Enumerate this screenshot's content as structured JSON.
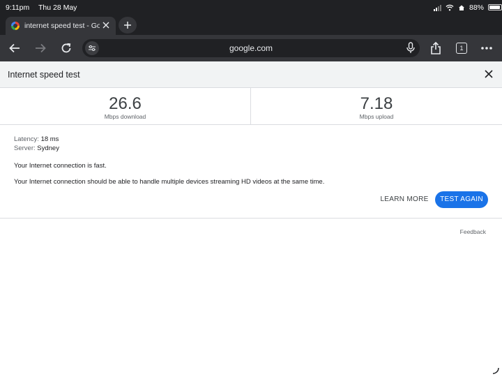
{
  "status_bar": {
    "time": "9:11pm",
    "date": "Thu 28 May",
    "battery": "88%"
  },
  "browser": {
    "tab": {
      "title": "internet speed test - Google Search"
    },
    "omnibox": {
      "url": "google.com"
    },
    "tab_count": "1"
  },
  "speed_test": {
    "header_title": "Internet speed test",
    "download": {
      "value": "26.6",
      "unit": "Mbps download"
    },
    "upload": {
      "value": "7.18",
      "unit": "Mbps upload"
    },
    "latency": {
      "label": "Latency:",
      "value": "18 ms"
    },
    "server": {
      "label": "Server:",
      "value": "Sydney"
    },
    "message_primary": "Your Internet connection is fast.",
    "message_secondary": "Your Internet connection should be able to handle multiple devices streaming HD videos at the same time.",
    "learn_more_label": "LEARN MORE",
    "test_again_label": "TEST AGAIN",
    "feedback_label": "Feedback"
  },
  "colors": {
    "accent": "#1a73e8",
    "chrome_dark": "#202124",
    "toolbar": "#35363a"
  },
  "icons": [
    "back-arrow-icon",
    "forward-arrow-icon",
    "reload-icon",
    "site-info-icon",
    "mic-icon",
    "share-icon",
    "tab-switcher-icon",
    "more-options-icon",
    "close-icon",
    "plus-icon"
  ]
}
